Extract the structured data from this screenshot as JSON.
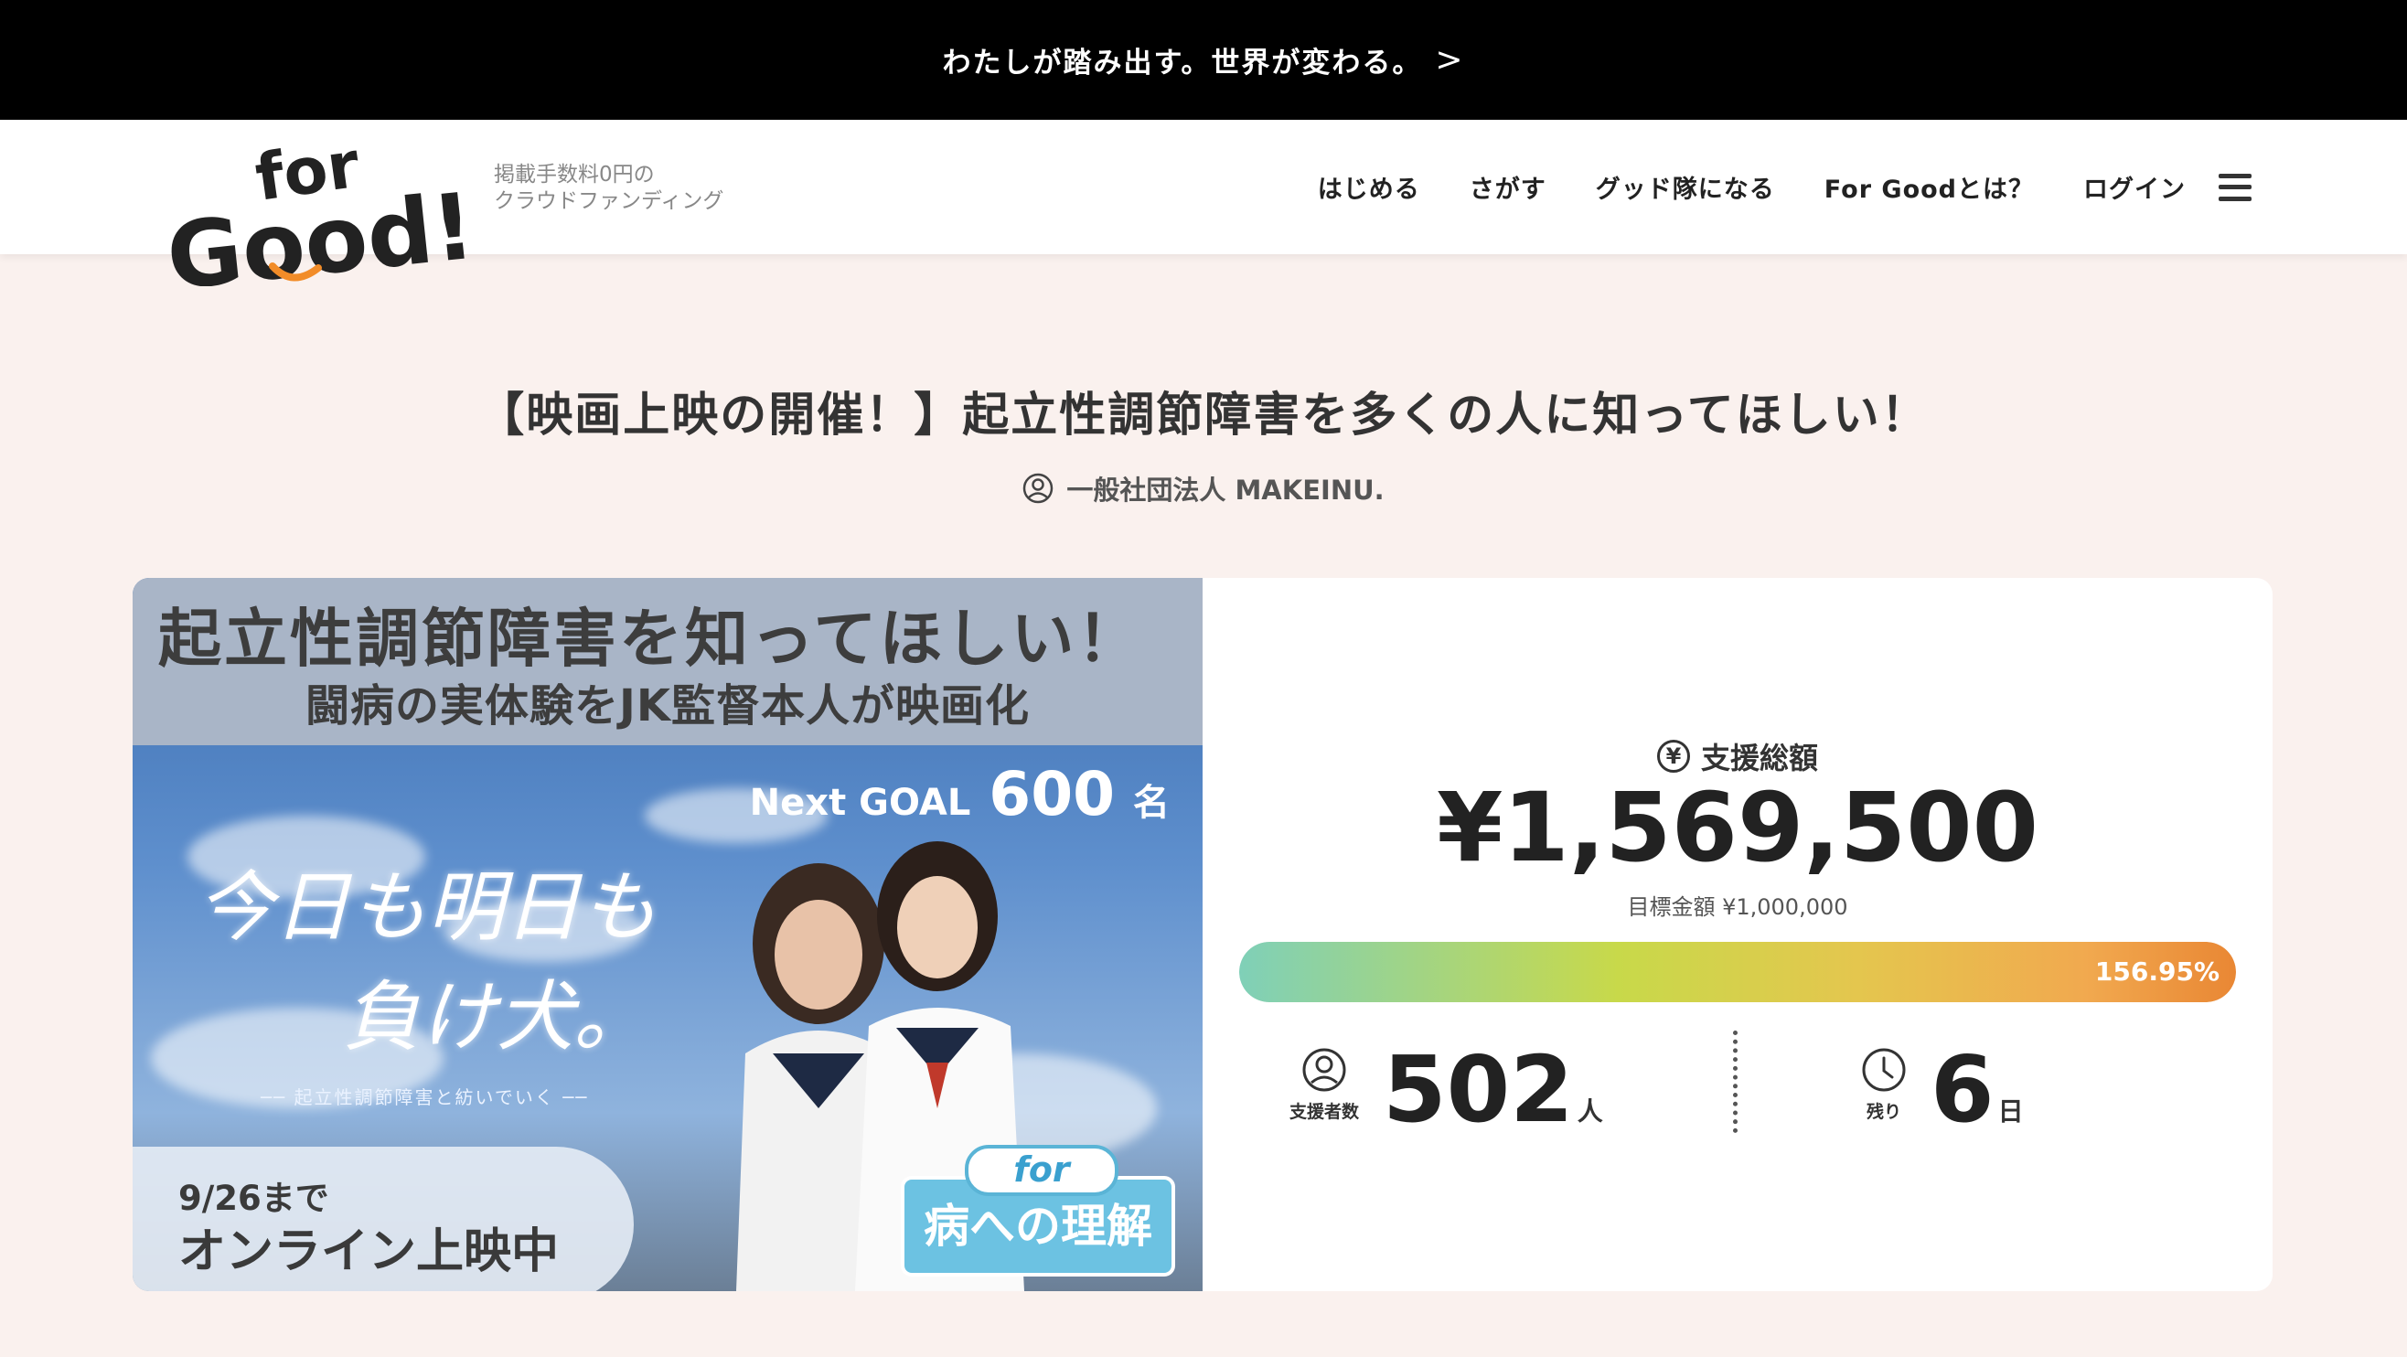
{
  "announcement": {
    "text": "わたしが踏み出す。世界が変わる。",
    "chevron": ">"
  },
  "header": {
    "logo_text": "for Good!",
    "tagline_line1": "掲載手数料0円の",
    "tagline_line2": "クラウドファンディング",
    "nav": [
      {
        "label": "はじめる"
      },
      {
        "label": "さがす"
      },
      {
        "label": "グッド隊になる"
      },
      {
        "label": "For Goodとは？"
      },
      {
        "label": "ログイン"
      }
    ],
    "menu_icon": "hamburger-menu-icon"
  },
  "project": {
    "title": "【映画上映の開催！】起立性調節障害を多くの人に知ってほしい！",
    "owner": "一般社団法人 MAKEINU.",
    "owner_icon": "user-circle-icon"
  },
  "hero": {
    "headline": "起立性調節障害を知ってほしい！",
    "subheadline": "闘病の実体験をJK監督本人が映画化",
    "next_goal_label": "Next GOAL",
    "next_goal_value": "600",
    "next_goal_unit": "名",
    "film_title_line1": "今日も明日も",
    "film_title_line2": "負け犬。",
    "film_subtitle": "── 起立性調節障害と紡いでいく ──",
    "deadline": "9/26まで",
    "screening": "オンライン上映中",
    "badge_for": "for",
    "badge_text": "病への理解"
  },
  "stats": {
    "amount_label": "支援総額",
    "amount": "¥1,569,500",
    "target": "目標金額 ¥1,000,000",
    "progress_percent": 156.95,
    "progress_label": "156.95%",
    "supporters_label": "支援者数",
    "supporters_value": "502",
    "supporters_unit": "人",
    "remaining_label": "残り",
    "remaining_value": "6",
    "remaining_unit": "日"
  },
  "colors": {
    "topbar": "#000000",
    "page_bg": "#faf1ee",
    "logo_smile": "#f28c28",
    "bar_start": "#7fd0b8",
    "bar_end": "#e98734",
    "badge_blue": "#6cc2e2"
  }
}
